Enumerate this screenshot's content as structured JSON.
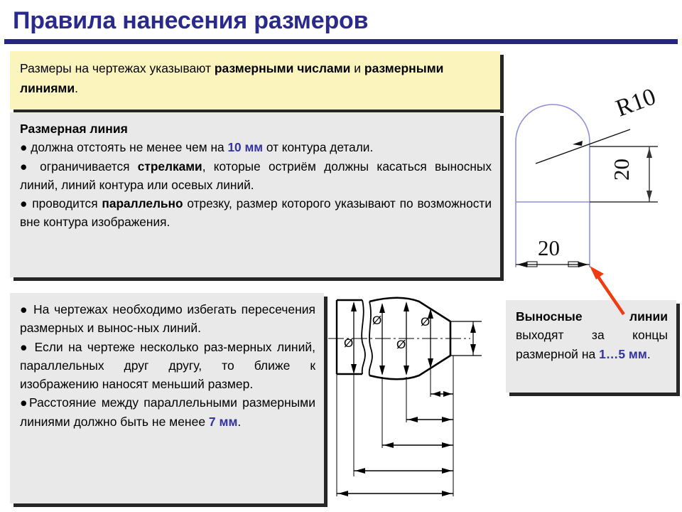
{
  "slide": {
    "title": "Правила нанесения размеров"
  },
  "panels": {
    "intro": {
      "name": "intro-yellow-box",
      "text_before": "Размеры на чертежах указывают ",
      "bold_1": "размерными числами",
      "text_mid": " и ",
      "bold_2": "размерными линиями",
      "text_end": "."
    },
    "dimension_line": {
      "heading": "Размерная линия",
      "bullet1_a": "● должна отстоять не менее чем на ",
      "bullet1_accent": "10 мм",
      "bullet1_b": " от контура детали.",
      "bullet2_a": "● ограничивается ",
      "bullet2_bold": "стрелками",
      "bullet2_b": ", которые остриём должны касаться выносных линий, линий контура или осевых линий.",
      "bullet3_a": "●  проводится ",
      "bullet3_bold": "параллельно",
      "bullet3_b": " отрезку, размер которого указывают по возможности вне контура изображения."
    },
    "avoid": {
      "bullet1": "● На чертежах необходимо избегать пересечения размерных и вынос-ных линий.",
      "bullet2": "● Если на чертеже несколько раз-мерных линий, параллельных друг другу, то ближе к изображению наносят меньший размер.",
      "bullet3_a": "●Расстояние между параллельными размерными линиями должно быть не менее ",
      "bullet3_accent": "7 мм",
      "bullet3_b": "."
    },
    "extension": {
      "bold_head": "Выносные  линии",
      "text_a": " выходят за концы размерной на ",
      "accent": "1…5 мм",
      "text_b": "."
    }
  },
  "figures": {
    "arc_part": {
      "name": "arc-dimension-drawing",
      "radius_label": "R10",
      "height_label": "20",
      "width_label": "20",
      "outline_color": "#8f90d8",
      "pointer_color": "#f03c11"
    },
    "shaft_part": {
      "name": "stepped-shaft-drawing",
      "diameter_symbol": "Ø",
      "diameter_count": 4,
      "horizontal_dimension_count": 5,
      "line_color": "#000000"
    }
  },
  "colors": {
    "title_blue": "#2a2a8c",
    "rule_blue": "#262680",
    "accent_blue": "#3333a2",
    "yellow_panel": "#fbf4bd",
    "gray_panel": "#e9e9e9",
    "shadow": "#262626",
    "red_arrow": "#f03c11"
  }
}
